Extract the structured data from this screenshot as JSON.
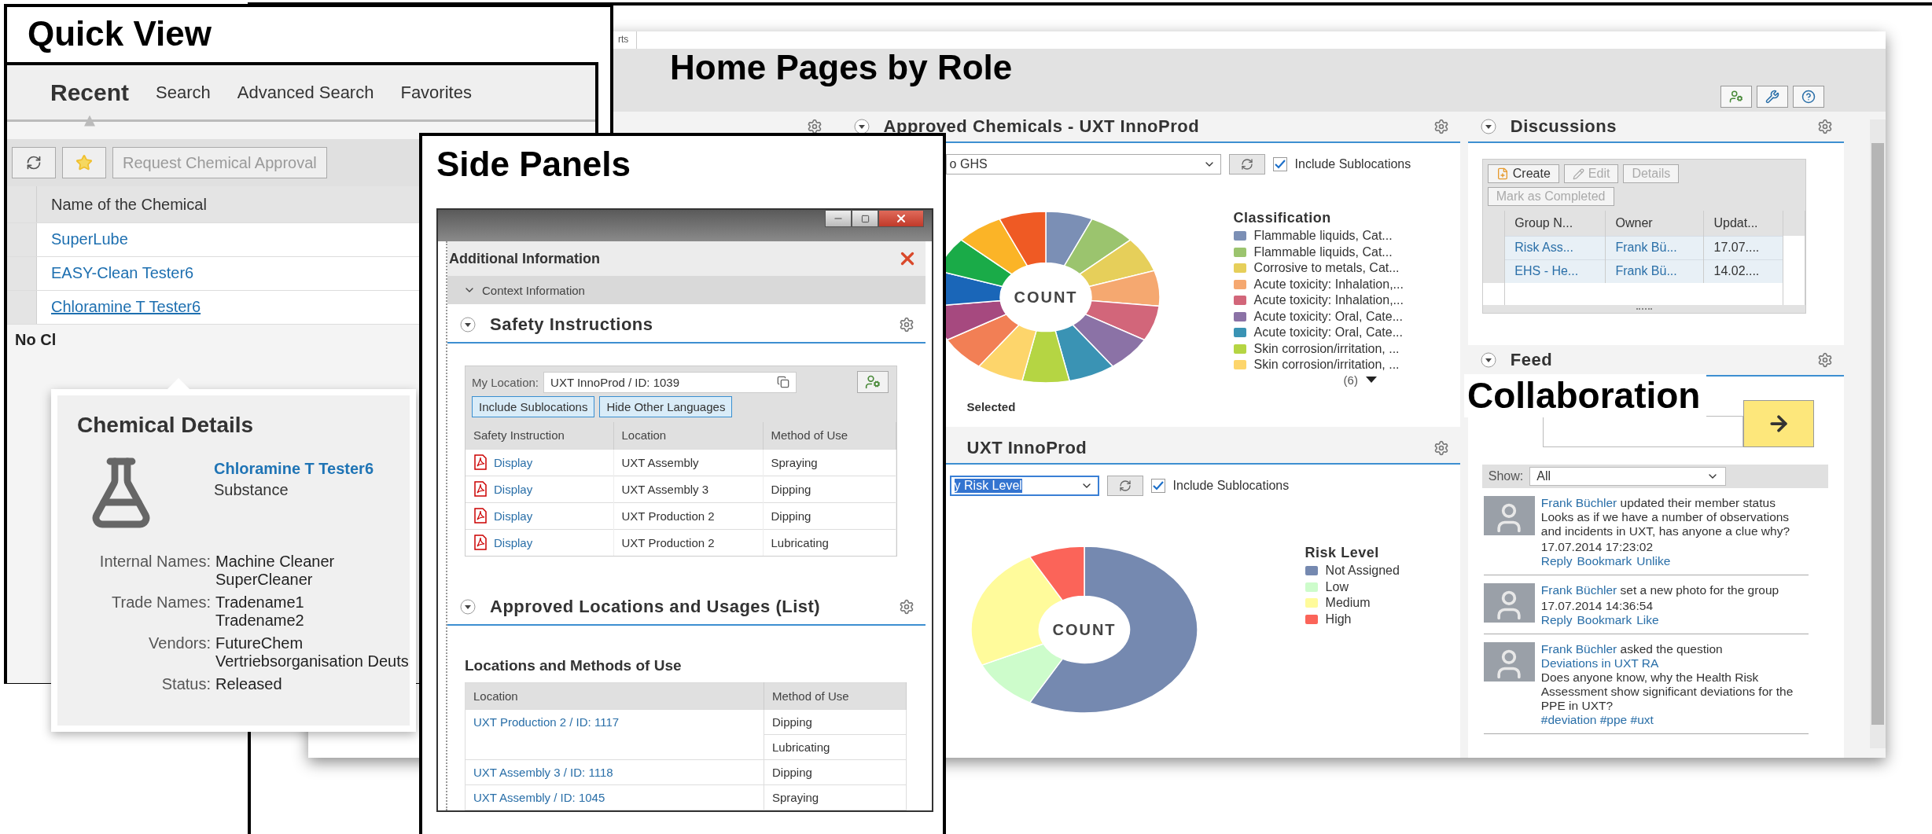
{
  "home_pages": {
    "label": "Home Pages by Role",
    "tab_fragment": "rts",
    "approved_chemicals": {
      "title": "Approved Chemicals - UXT InnoProd",
      "dropdown": "o GHS",
      "dropdown_highlighted": false,
      "include_sublocations": {
        "label": "Include Sublocations",
        "checked": true
      },
      "center_label": "COUNT",
      "legend_title": "Classification",
      "legend": [
        {
          "label": "Flammable liquids, Cat...",
          "color": "#7b8fb5"
        },
        {
          "label": "Flammable liquids, Cat...",
          "color": "#9bc46e"
        },
        {
          "label": "Corrosive to metals, Cat...",
          "color": "#e6cf5a"
        },
        {
          "label": "Acute toxicity: Inhalation,...",
          "color": "#f5a870"
        },
        {
          "label": "Acute toxicity: Inhalation,...",
          "color": "#d2667a"
        },
        {
          "label": "Acute toxicity: Oral, Cate...",
          "color": "#8b72a6"
        },
        {
          "label": "Acute toxicity: Oral, Cate...",
          "color": "#3a93b4"
        },
        {
          "label": "Skin corrosion/irritation, ...",
          "color": "#b5d543"
        },
        {
          "label": "Skin corrosion/irritation, ...",
          "color": "#fdd56b"
        }
      ],
      "more": "(6)",
      "footer": "Selected"
    },
    "risk_level": {
      "title": "UXT InnoProd",
      "dropdown": "y Risk Level",
      "dropdown_highlighted": true,
      "include_sublocations": {
        "label": "Include Sublocations",
        "checked": true
      },
      "center_label": "COUNT",
      "legend_title": "Risk Level",
      "legend": [
        {
          "label": "Not Assigned",
          "color": "#7589b0"
        },
        {
          "label": "Low",
          "color": "#cdfccb"
        },
        {
          "label": "Medium",
          "color": "#fffb9b"
        },
        {
          "label": "High",
          "color": "#fb6459"
        }
      ]
    },
    "discussions": {
      "title": "Discussions",
      "buttons": [
        {
          "label": "Create",
          "kind": "create",
          "disabled": false
        },
        {
          "label": "Edit",
          "kind": "edit",
          "disabled": true
        },
        {
          "label": "Details",
          "kind": "plain",
          "disabled": true
        },
        {
          "label": "Mark as Completed",
          "kind": "plain",
          "disabled": true
        }
      ],
      "columns": [
        "Group N...",
        "Owner",
        "Updat..."
      ],
      "rows": [
        {
          "cells": [
            "Risk Ass...",
            "Frank Bü...",
            "17.07...."
          ]
        },
        {
          "cells": [
            "EHS - He...",
            "Frank Bü...",
            "14.02...."
          ]
        }
      ]
    },
    "feed": {
      "title": "Feed",
      "show_label": "Show:",
      "show_value": "All",
      "items": [
        {
          "user": "Frank Büchler",
          "action": "updated their member status",
          "message": "Looks as if we have a number of observations and incidents in UXT, has anyone a clue why?",
          "time": "17.07.2014 17:23:02",
          "actions": [
            "Reply",
            "Bookmark",
            "Unlike"
          ]
        },
        {
          "user": "Frank Büchler",
          "action": "set a new photo for the group",
          "time": "17.07.2014 14:36:54",
          "actions": [
            "Reply",
            "Bookmark",
            "Like"
          ]
        },
        {
          "user": "Frank Büchler",
          "action": "asked the question",
          "topic": "Deviations in UXT RA",
          "message": "Does anyone know, why the Health Risk Assessment show significant deviations for the PPE in UXT?",
          "tags": "#deviation #ppe #uxt"
        }
      ]
    },
    "collaboration_label": "Collaboration"
  },
  "quick_view": {
    "label": "Quick View",
    "tabs": [
      {
        "label": "Recent",
        "selected": true
      },
      {
        "label": "Search",
        "selected": false
      },
      {
        "label": "Advanced Search",
        "selected": false
      },
      {
        "label": "Favorites",
        "selected": false
      }
    ],
    "toolbar_button": {
      "label": "Request Chemical Approval",
      "disabled": true
    },
    "column": "Name of the Chemical",
    "rows": [
      {
        "name": "SuperLube",
        "hovered": false
      },
      {
        "name": "EASY-Clean Tester6",
        "hovered": false
      },
      {
        "name": "Chloramine T Tester6",
        "hovered": true
      }
    ],
    "empty_text": "No Cl",
    "details": {
      "title": "Chemical Details",
      "name": "Chloramine T Tester6",
      "type": "Substance",
      "fields": [
        {
          "label": "Internal Names:",
          "values": [
            "Machine Cleaner",
            "SuperCleaner"
          ]
        },
        {
          "label": "Trade Names:",
          "values": [
            "Tradename1",
            "Tradename2"
          ]
        },
        {
          "label": "Vendors:",
          "values": [
            "FutureChem",
            "Vertriebsorganisation Deuts"
          ]
        },
        {
          "label": "Status:",
          "values": [
            "Released"
          ]
        }
      ]
    }
  },
  "side_panels": {
    "label": "Side Panels",
    "panel_title": "Additional Information",
    "context": "Context Information",
    "safety": {
      "title": "Safety Instructions",
      "location_label": "My Location:",
      "location_value": "UXT InnoProd / ID: 1039",
      "buttons": [
        "Include Sublocations",
        "Hide Other Languages"
      ],
      "columns": [
        "Safety Instruction",
        "Location",
        "Method of Use"
      ],
      "rows": [
        {
          "link": "Display",
          "location": "UXT Assembly",
          "method": "Spraying"
        },
        {
          "link": "Display",
          "location": "UXT Assembly 3",
          "method": "Dipping"
        },
        {
          "link": "Display",
          "location": "UXT Production 2",
          "method": "Dipping"
        },
        {
          "link": "Display",
          "location": "UXT Production 2",
          "method": "Lubricating"
        }
      ]
    },
    "approved": {
      "title": "Approved Locations and Usages (List)",
      "subtitle": "Locations and Methods of Use",
      "columns": [
        "Location",
        "Method of Use"
      ],
      "rows": [
        {
          "location": "UXT Production 2 / ID: 1117",
          "methods": [
            "Dipping",
            "Lubricating"
          ]
        },
        {
          "location": "UXT Assembly 3 / ID: 1118",
          "methods": [
            "Dipping"
          ]
        },
        {
          "location": "UXT Assembly / ID: 1045",
          "methods": [
            "Spraying"
          ]
        }
      ]
    }
  }
}
